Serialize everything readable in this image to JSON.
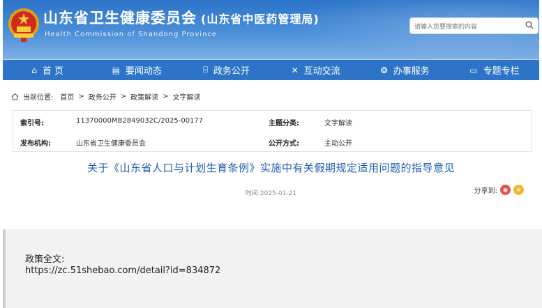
{
  "site": {
    "title_cn": "山东省卫生健康委员会",
    "title_sub": "(山东省中医药管理局)",
    "title_en": "Health Commission of Shandong Province",
    "search_placeholder": "请输入您要搜索的内容"
  },
  "nav": [
    {
      "label": "首 页",
      "icon": "home-icon"
    },
    {
      "label": "要闻动态",
      "icon": "news-icon"
    },
    {
      "label": "政务公开",
      "icon": "building-icon"
    },
    {
      "label": "互动交流",
      "icon": "exchange-icon"
    },
    {
      "label": "办事服务",
      "icon": "service-icon"
    },
    {
      "label": "专题专栏",
      "icon": "column-icon"
    }
  ],
  "breadcrumb": {
    "prefix": "当前位置:",
    "items": [
      "首页",
      "政务公开",
      "政策解读",
      "文字解读"
    ],
    "separator": ">"
  },
  "meta": {
    "index_label": "索引号:",
    "index_value": "11370000MB2849032C/2025-00177",
    "topic_label": "主题分类:",
    "topic_value": "文字解读",
    "publisher_label": "发布机构:",
    "publisher_value": "山东省卫生健康委员会",
    "mode_label": "公开方式:",
    "mode_value": "主动公开"
  },
  "article": {
    "title": "关于《山东省人口与计划生育条例》实施中有关假期规定适用问题的指导意见",
    "time": "时间:2025-01-21",
    "share_label": "分享到:"
  },
  "quote": {
    "line1": "政策全文:",
    "line2": "https://zc.51shebao.com/detail?id=834872"
  },
  "colors": {
    "header_blue": "#2c74c9",
    "nav_blue": "#2d74c8",
    "title_blue": "#1f5fb3",
    "weibo_red": "#e0564f",
    "qzone_yellow": "#f2b82d"
  }
}
